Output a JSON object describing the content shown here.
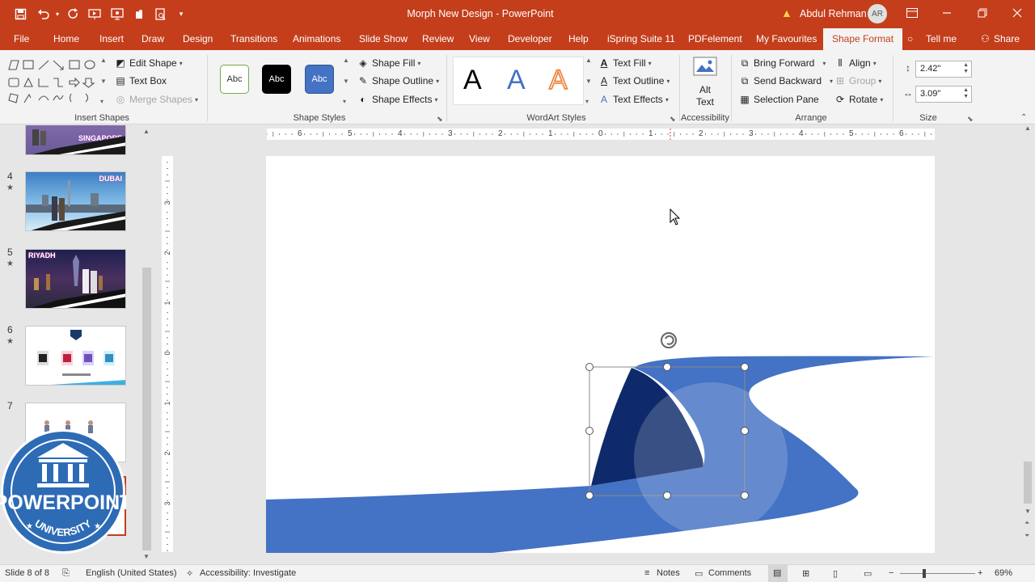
{
  "title_bar": {
    "document_title": "Morph New Design - PowerPoint",
    "user_name": "Abdul Rehman",
    "user_initials": "AR",
    "qat_icons": [
      "save-icon",
      "undo-icon",
      "redo-icon",
      "start-from-beginning-icon",
      "touch-mode-icon",
      "present-icon",
      "print-preview-icon",
      "customize-qat-icon"
    ]
  },
  "tabs": [
    "File",
    "Home",
    "Insert",
    "Draw",
    "Design",
    "Transitions",
    "Animations",
    "Slide Show",
    "Review",
    "View",
    "Developer",
    "Help",
    "iSpring Suite 11",
    "PDFelement",
    "My Favourites",
    "Shape Format",
    "Tell me",
    "Share"
  ],
  "active_tab": "Shape Format",
  "ribbon": {
    "insert_shapes": {
      "label": "Insert Shapes",
      "edit_shape": "Edit Shape",
      "text_box": "Text Box",
      "merge_shapes": "Merge Shapes"
    },
    "shape_styles": {
      "label": "Shape Styles",
      "sample_text": "Abc",
      "shape_fill": "Shape Fill",
      "shape_outline": "Shape Outline",
      "shape_effects": "Shape Effects"
    },
    "wordart_styles": {
      "label": "WordArt Styles",
      "sample_letter": "A",
      "text_fill": "Text Fill",
      "text_outline": "Text Outline",
      "text_effects": "Text Effects"
    },
    "accessibility": {
      "label": "Accessibility",
      "alt_text_line1": "Alt",
      "alt_text_line2": "Text"
    },
    "arrange": {
      "label": "Arrange",
      "bring_forward": "Bring Forward",
      "send_backward": "Send Backward",
      "selection_pane": "Selection Pane",
      "align": "Align",
      "group": "Group",
      "rotate": "Rotate"
    },
    "size": {
      "label": "Size",
      "height": "2.42\"",
      "width": "3.09\""
    }
  },
  "slides_panel": {
    "items": [
      {
        "number": "",
        "caption": "SINGAPORE"
      },
      {
        "number": "4",
        "caption": "DUBAI"
      },
      {
        "number": "5",
        "caption": "RIYADH"
      },
      {
        "number": "6",
        "caption": ""
      },
      {
        "number": "7",
        "caption": ""
      }
    ],
    "star": "★"
  },
  "ruler": {
    "horizontal": [
      "6",
      "5",
      "4",
      "3",
      "2",
      "1",
      "0",
      "1",
      "2",
      "3",
      "4",
      "5",
      "6"
    ],
    "vertical": [
      "3",
      "2",
      "1",
      "0",
      "1",
      "2",
      "3"
    ]
  },
  "watermark": {
    "main": "POWERPOINT",
    "sub": "UNIVERSITY"
  },
  "status_bar": {
    "slide_info": "Slide 8 of 8",
    "language": "English (United States)",
    "accessibility": "Accessibility: Investigate",
    "notes": "Notes",
    "comments": "Comments",
    "zoom": "69%"
  },
  "colors": {
    "accent": "#c43e1c",
    "wave_blue": "#4472c4",
    "wave_dark": "#0e2a6b"
  }
}
